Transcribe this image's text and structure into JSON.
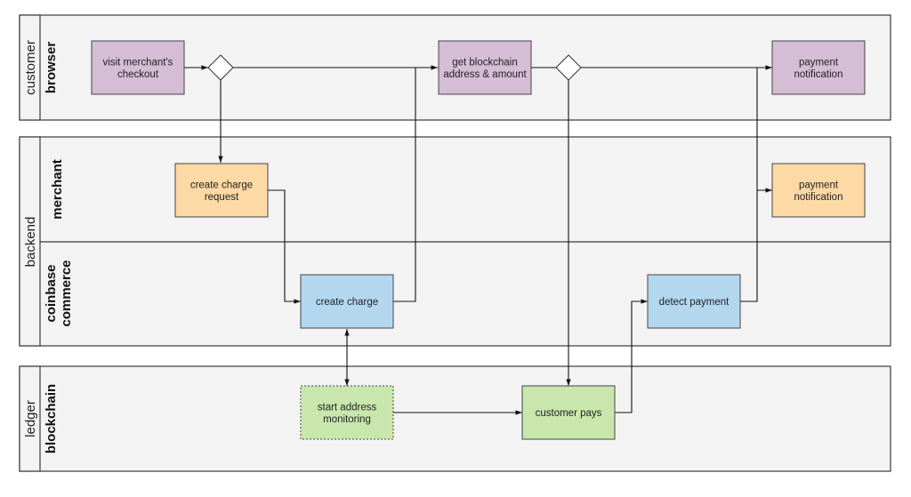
{
  "diagram": {
    "type": "swimlane-flowchart",
    "pools": [
      {
        "id": "customer",
        "title": "customer",
        "lanes": [
          {
            "id": "browser",
            "title": [
              "browser"
            ]
          }
        ]
      },
      {
        "id": "backend",
        "title": "backend",
        "lanes": [
          {
            "id": "merchant",
            "title": [
              "merchant"
            ]
          },
          {
            "id": "coinbase",
            "title": [
              "coinbase",
              "commerce"
            ]
          }
        ]
      },
      {
        "id": "ledger",
        "title": "ledger",
        "lanes": [
          {
            "id": "blockchain",
            "title": [
              "blockchain"
            ]
          }
        ]
      }
    ],
    "nodes": [
      {
        "id": "visit",
        "lane": "browser",
        "lines": [
          "visit merchant's",
          "checkout"
        ],
        "fill": "#d5bdd5",
        "style": "solid"
      },
      {
        "id": "get_addr",
        "lane": "browser",
        "lines": [
          "get blockchain",
          "address & amount"
        ],
        "fill": "#d5bdd5",
        "style": "solid"
      },
      {
        "id": "notify_browser",
        "lane": "browser",
        "lines": [
          "payment",
          "notification"
        ],
        "fill": "#d5bdd5",
        "style": "solid"
      },
      {
        "id": "charge_req",
        "lane": "merchant",
        "lines": [
          "create charge",
          "request"
        ],
        "fill": "#fdd9a5",
        "style": "solid"
      },
      {
        "id": "notify_merchant",
        "lane": "merchant",
        "lines": [
          "payment",
          "notification"
        ],
        "fill": "#fdd9a5",
        "style": "solid"
      },
      {
        "id": "create_charge",
        "lane": "coinbase",
        "lines": [
          "create charge"
        ],
        "fill": "#b4d7f0",
        "style": "solid"
      },
      {
        "id": "detect",
        "lane": "coinbase",
        "lines": [
          "detect payment"
        ],
        "fill": "#b4d7f0",
        "style": "solid"
      },
      {
        "id": "monitor",
        "lane": "blockchain",
        "lines": [
          "start address",
          "monitoring"
        ],
        "fill": "#c9e7ad",
        "style": "dotted"
      },
      {
        "id": "pays",
        "lane": "blockchain",
        "lines": [
          "customer pays"
        ],
        "fill": "#c9e7ad",
        "style": "solid"
      }
    ],
    "gateways": [
      {
        "id": "gw1",
        "lane": "browser"
      },
      {
        "id": "gw2",
        "lane": "browser"
      }
    ],
    "edges": [
      {
        "from": "visit",
        "to": "gw1"
      },
      {
        "from": "gw1",
        "to": "get_addr"
      },
      {
        "from": "gw1",
        "to": "charge_req"
      },
      {
        "from": "charge_req",
        "to": "create_charge"
      },
      {
        "from": "create_charge",
        "to": "get_addr"
      },
      {
        "from": "create_charge",
        "to": "monitor",
        "bidirectional": true
      },
      {
        "from": "get_addr",
        "to": "gw2"
      },
      {
        "from": "gw2",
        "to": "notify_browser"
      },
      {
        "from": "gw2",
        "to": "pays"
      },
      {
        "from": "monitor",
        "to": "pays"
      },
      {
        "from": "pays",
        "to": "detect"
      },
      {
        "from": "detect",
        "to": "notify_browser"
      },
      {
        "from": "detect",
        "to": "notify_merchant"
      }
    ]
  }
}
